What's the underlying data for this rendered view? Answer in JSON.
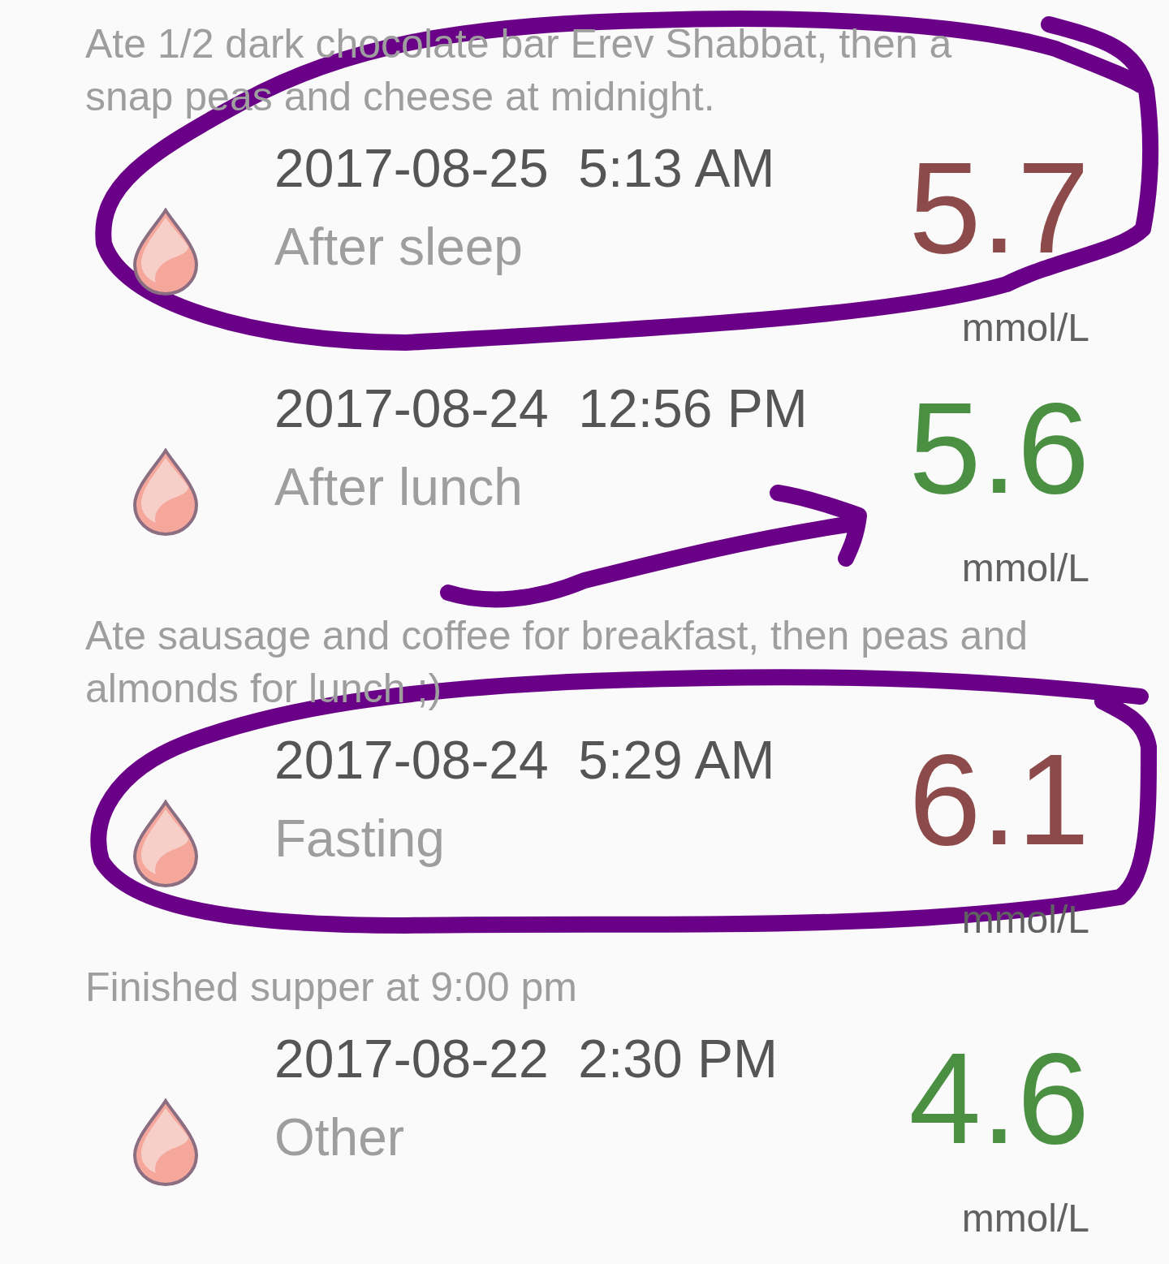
{
  "entries": [
    {
      "note": "Ate 1/2 dark chocolate bar Erev Shabbat, then a snap peas and cheese at midnight.",
      "datetime": "2017-08-25  5:13 AM",
      "category": "After sleep",
      "value": "5.7",
      "color": "#8d4a4a",
      "unit": "mmol/L"
    },
    {
      "datetime": "2017-08-24  12:56 PM",
      "category": "After lunch",
      "value": "5.6",
      "color": "#4a8f42",
      "unit": "mmol/L"
    },
    {
      "note": "Ate sausage and coffee for breakfast, then peas and almonds for lunch ;)",
      "datetime": "2017-08-24  5:29 AM",
      "category": "Fasting",
      "value": "6.1",
      "color": "#8d4a4a",
      "unit": "mmol/L"
    },
    {
      "note": "Finished supper at 9:00 pm",
      "datetime": "2017-08-22  2:30 PM",
      "category": "Other",
      "value": "4.6",
      "color": "#4a8f42",
      "unit": "mmol/L"
    }
  ]
}
